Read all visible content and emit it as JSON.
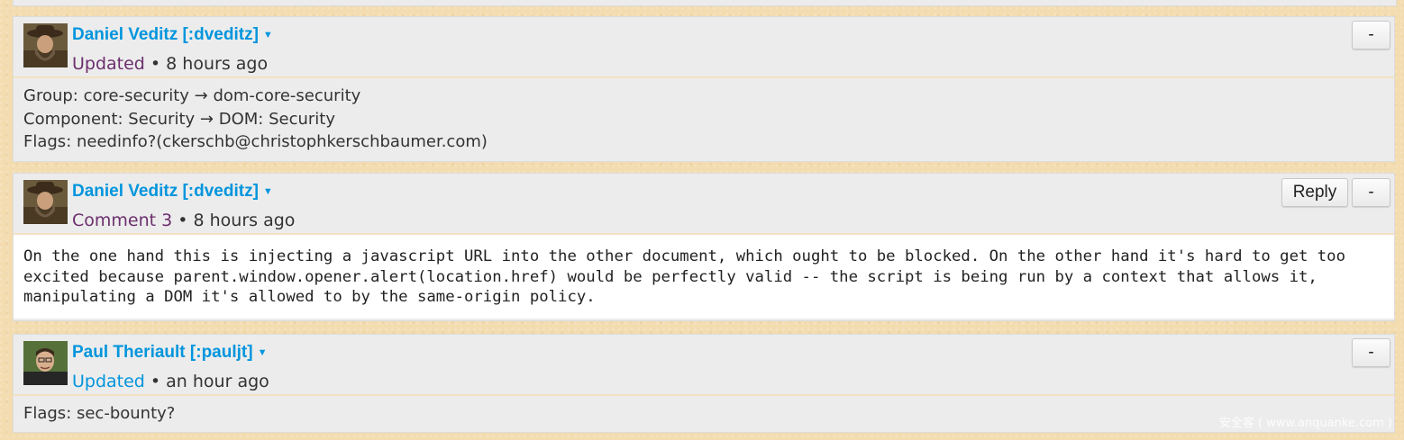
{
  "activity": [
    {
      "author": "Daniel Veditz [:dveditz]",
      "kind": "Updated",
      "time": "• 8 hours ago",
      "changes": [
        "Group: core-security → dom-core-security",
        "Component: Security → DOM: Security",
        "Flags: needinfo?(ckerschb@christophkerschbaumer.com)"
      ],
      "collapse_label": "-"
    },
    {
      "author": "Daniel Veditz [:dveditz]",
      "kind": "Comment 3",
      "time": "• 8 hours ago",
      "reply_label": "Reply",
      "collapse_label": "-",
      "body": "On the one hand this is injecting a javascript URL into the other document, which ought to be blocked. On the other hand it's hard to get too excited because parent.window.opener.alert(location.href) would be perfectly valid -- the script is being run by a context that allows it, manipulating a DOM it's allowed to by the same-origin policy."
    },
    {
      "author": "Paul Theriault [:pauljt]",
      "kind": "Updated",
      "time": "• an hour ago",
      "changes": [
        "Flags: sec-bounty?"
      ],
      "collapse_label": "-"
    }
  ],
  "watermark": "安全客 ( www.anquanke.com )",
  "colors": {
    "author_link": "#0095dd",
    "activity_kind": "#6b2f6e",
    "page_background": "#f3dcb0",
    "card_background": "#ececec"
  }
}
